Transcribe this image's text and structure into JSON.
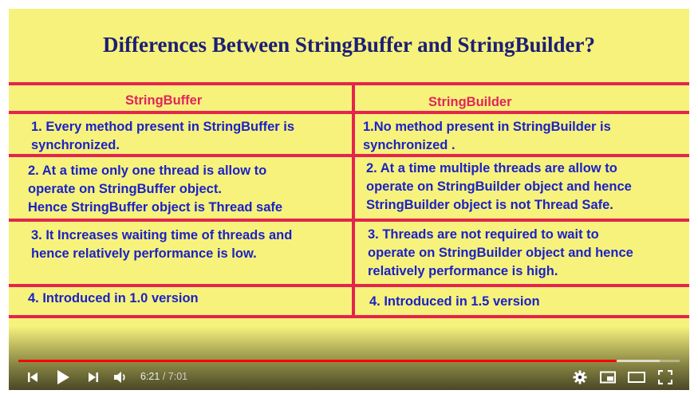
{
  "slide": {
    "title": "Differences Between StringBuffer and StringBuilder?",
    "columns": [
      "StringBuffer",
      "StringBuilder"
    ],
    "rows": [
      {
        "left": [
          "1.  Every method present in StringBuffer is",
          "synchronized."
        ],
        "right": [
          "1.No method present in StringBuilder is",
          "synchronized ."
        ]
      },
      {
        "left": [
          "2. At a time only one thread is allow to",
          "operate on StringBuffer object.",
          "Hence StringBuffer object is Thread safe"
        ],
        "right": [
          "2. At a time multiple threads are allow to",
          "operate on StringBuilder object and hence",
          "StringBuilder object is not Thread Safe."
        ]
      },
      {
        "left": [
          "3. It Increases waiting time of threads and",
          "hence relatively performance is low."
        ],
        "right": [
          "3. Threads are not required to wait to",
          "operate on StringBuilder object and hence",
          "relatively performance is high."
        ]
      },
      {
        "left": [
          "4. Introduced in 1.0 version"
        ],
        "right": [
          "4. Introduced in 1.5 version"
        ]
      }
    ],
    "colors": {
      "background": "#f7f27c",
      "title": "#1c1f73",
      "header": "#e0245c",
      "body": "#1b22c4",
      "grid": "#e4244c"
    }
  },
  "player": {
    "current_time": "6:21",
    "separator": "/",
    "duration": "7:01",
    "progress_fraction": 0.905,
    "buffered_fraction": 0.97,
    "controls": {
      "prev": "skip-previous-icon",
      "play": "play-icon",
      "next": "skip-next-icon",
      "volume": "volume-icon",
      "settings": "gear-icon",
      "miniplayer": "miniplayer-icon",
      "theater": "theater-mode-icon",
      "fullscreen": "fullscreen-icon"
    }
  }
}
